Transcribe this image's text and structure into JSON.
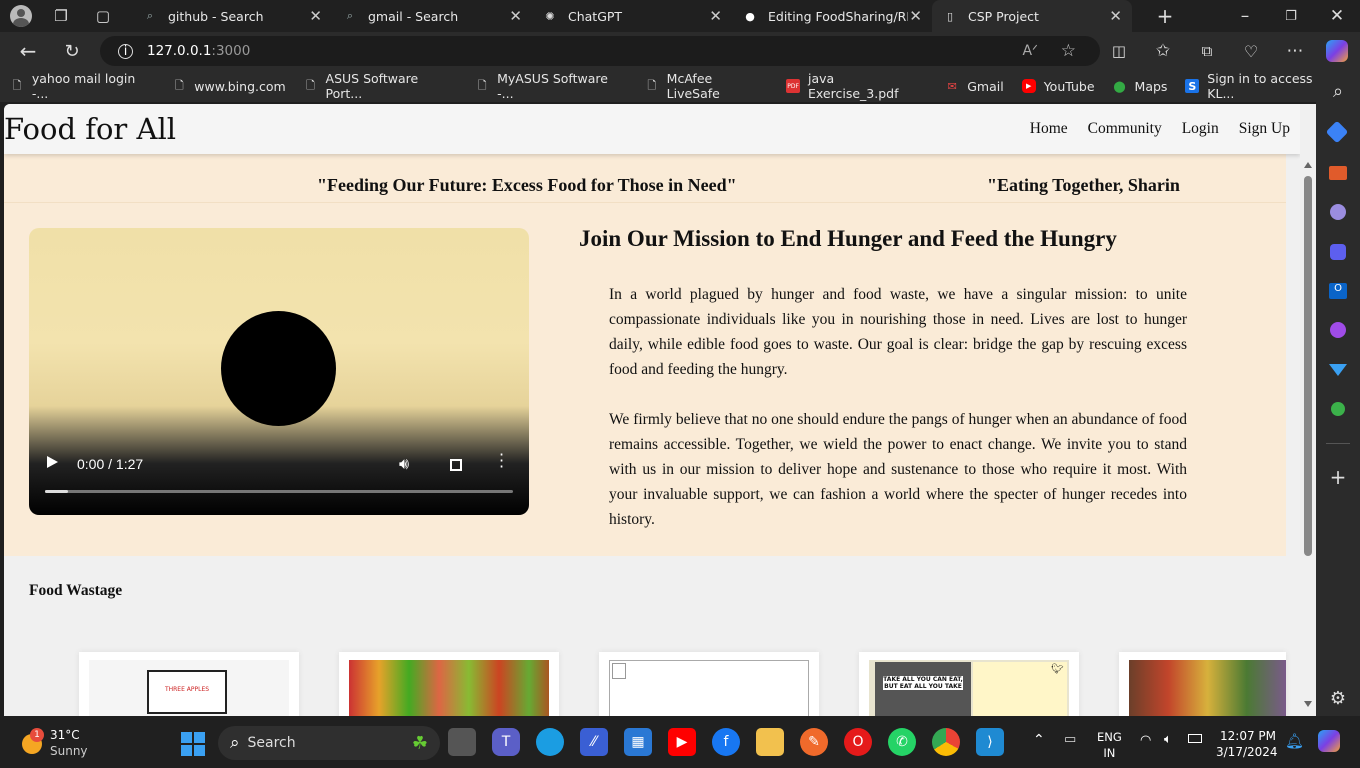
{
  "browser": {
    "tabs": [
      {
        "title": "github - Search",
        "icon": "search-icon"
      },
      {
        "title": "gmail - Search",
        "icon": "search-icon"
      },
      {
        "title": "ChatGPT",
        "icon": "chatgpt-icon"
      },
      {
        "title": "Editing FoodSharing/REA",
        "icon": "github-icon"
      },
      {
        "title": "CSP Project",
        "icon": "page-icon"
      }
    ],
    "url_host": "127.0.0.1",
    "url_port": ":3000",
    "bookmarks": [
      {
        "label": "yahoo mail login -...",
        "icon": "page-icon"
      },
      {
        "label": "www.bing.com",
        "icon": "page-icon"
      },
      {
        "label": "ASUS Software Port...",
        "icon": "page-icon"
      },
      {
        "label": "MyASUS Software -...",
        "icon": "page-icon"
      },
      {
        "label": "McAfee LiveSafe",
        "icon": "page-icon"
      },
      {
        "label": "java Exercise_3.pdf",
        "icon": "pdf-icon"
      },
      {
        "label": "Gmail",
        "icon": "gmail-icon"
      },
      {
        "label": "YouTube",
        "icon": "youtube-icon"
      },
      {
        "label": "Maps",
        "icon": "maps-icon"
      },
      {
        "label": "Sign in to access KL...",
        "icon": "s-icon"
      }
    ]
  },
  "site": {
    "brand": "Food for All",
    "nav": [
      "Home",
      "Community",
      "Login",
      "Sign Up"
    ],
    "marquee": [
      "\"Feeding Our Future: Excess Food for Those in Need\"",
      "\"Eating Together, Sharin"
    ],
    "video": {
      "time": "0:00 / 1:27",
      "progress": 0.05
    },
    "heading": "Join Our Mission to End Hunger and Feed the Hungry",
    "paragraph1": "In a world plagued by hunger and food waste, we have a singular mission: to unite compassionate individuals like you in nourishing those in need. Lives are lost to hunger daily, while edible food goes to waste. Our goal is clear: bridge the gap by rescuing excess food and feeding the hungry.",
    "paragraph2": "We firmly believe that no one should endure the pangs of hunger when an abundance of food remains accessible. Together, we wield the power to enact change. We invite you to stand with us in our mission to deliver hope and sustenance to those who require it most. With your invaluable support, we can fashion a world where the specter of hunger recedes into history.",
    "section_title": "Food Wastage",
    "cards": [
      {
        "caption": "THREE APPLES"
      },
      {
        "caption": ""
      },
      {
        "caption": ""
      },
      {
        "caption": "TAKE ALL YOU CAN EAT, BUT EAT ALL YOU TAKE"
      },
      {
        "caption": ""
      }
    ]
  },
  "taskbar": {
    "weather_temp": "31°C",
    "weather_desc": "Sunny",
    "weather_badge": "1",
    "search_placeholder": "Search",
    "lang_top": "ENG",
    "lang_bottom": "IN",
    "time": "12:07 PM",
    "date": "3/17/2024"
  }
}
